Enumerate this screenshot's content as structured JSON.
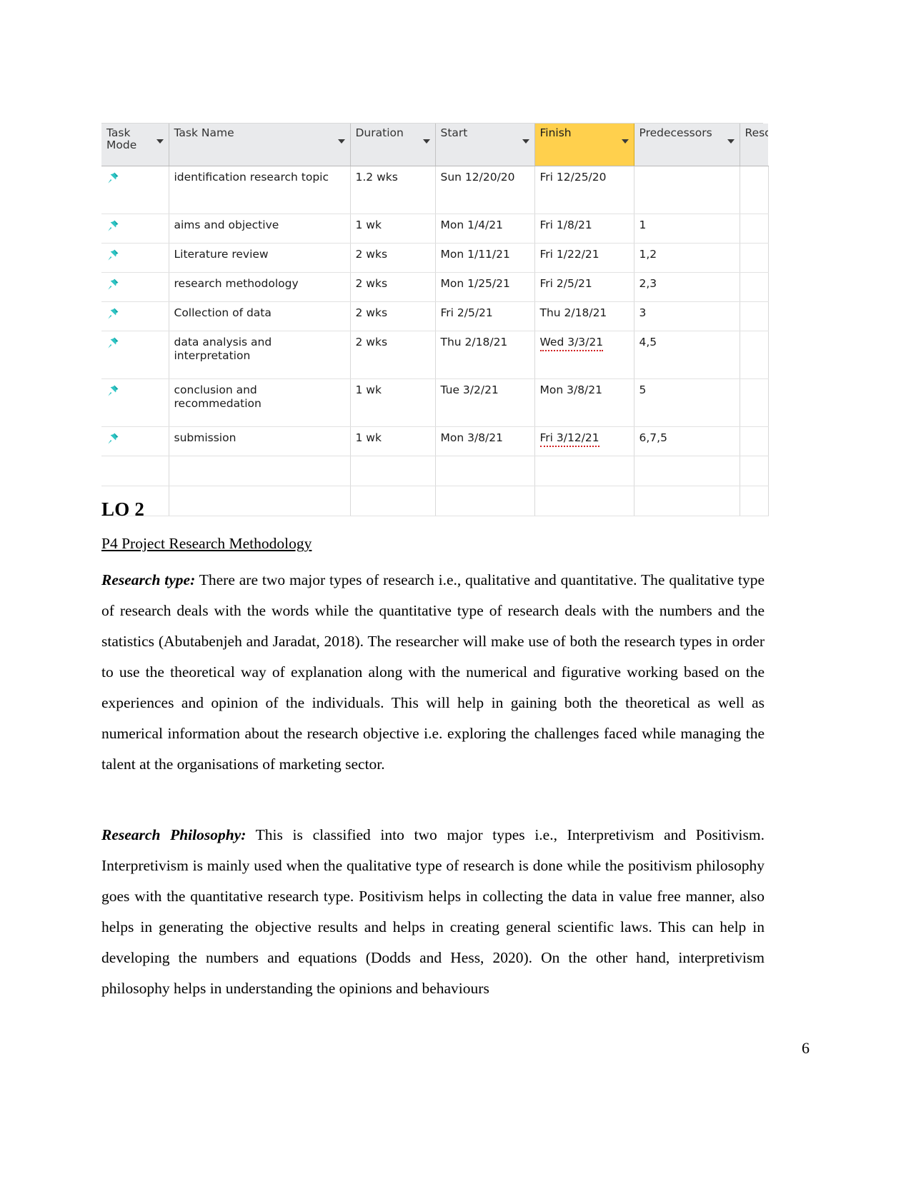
{
  "project_table": {
    "columns": [
      {
        "label": "Task Mode",
        "icon": "chevron-down-icon",
        "highlighted": false
      },
      {
        "label": "Task Name",
        "icon": "chevron-down-icon",
        "highlighted": false
      },
      {
        "label": "Duration",
        "icon": "chevron-down-icon",
        "highlighted": false
      },
      {
        "label": "Start",
        "icon": "chevron-down-icon",
        "highlighted": false
      },
      {
        "label": "Finish",
        "icon": "chevron-down-icon",
        "highlighted": true
      },
      {
        "label": "Predecessors",
        "icon": "chevron-down-icon",
        "highlighted": false
      },
      {
        "label": "Resc",
        "icon": "chevron-down-icon",
        "highlighted": false
      }
    ],
    "rows": [
      {
        "task_mode_icon": "pushpin-icon",
        "task_name": "identification research topic",
        "duration": "1.2 wks",
        "start": "Sun 12/20/20",
        "finish": "Fri 12/25/20",
        "predecessors": "",
        "resource": ""
      },
      {
        "task_mode_icon": "pushpin-icon",
        "task_name": "aims and objective",
        "duration": "1 wk",
        "start": "Mon 1/4/21",
        "finish": "Fri 1/8/21",
        "predecessors": "1",
        "resource": ""
      },
      {
        "task_mode_icon": "pushpin-icon",
        "task_name": "Literature review",
        "duration": "2 wks",
        "start": "Mon 1/11/21",
        "finish": "Fri 1/22/21",
        "predecessors": "1,2",
        "resource": ""
      },
      {
        "task_mode_icon": "pushpin-icon",
        "task_name": "research methodology",
        "duration": "2 wks",
        "start": "Mon 1/25/21",
        "finish": "Fri 2/5/21",
        "predecessors": "2,3",
        "resource": ""
      },
      {
        "task_mode_icon": "pushpin-icon",
        "task_name": "Collection of data",
        "duration": "2 wks",
        "start": "Fri 2/5/21",
        "finish": "Thu 2/18/21",
        "predecessors": "3",
        "resource": ""
      },
      {
        "task_mode_icon": "pushpin-icon",
        "task_name": "data analysis and interpretation",
        "duration": "2 wks",
        "start": "Thu 2/18/21",
        "finish": "Wed 3/3/21",
        "predecessors": "4,5",
        "resource": ""
      },
      {
        "task_mode_icon": "pushpin-icon",
        "task_name": "conclusion and recommedation",
        "duration": "1 wk",
        "start": "Tue 3/2/21",
        "finish": "Mon 3/8/21",
        "predecessors": "5",
        "resource": ""
      },
      {
        "task_mode_icon": "pushpin-icon",
        "task_name": "submission",
        "duration": "1 wk",
        "start": "Mon 3/8/21",
        "finish": "Fri 3/12/21",
        "predecessors": "6,7,5",
        "resource": ""
      }
    ],
    "colors": {
      "header_background": "#e9eaec",
      "header_highlight": "#ffd04d",
      "selection_tint": "#e4edf7",
      "pushpin": "#2ec4c4",
      "spellcheck_underline": "#d01f1f",
      "grid_line": "#e2e2e2"
    }
  },
  "document": {
    "heading": "LO 2",
    "subheading": "P4 Project Research Methodology",
    "paragraph_1": {
      "lead": "Research type:",
      "text": " There are two major types of research i.e., qualitative and quantitative. The qualitative type of research deals with the words while the quantitative type of research deals with the numbers and the statistics (Abutabenjeh and Jaradat, 2018). The researcher will make use of both the research types in order to use the theoretical way of explanation along with the numerical and figurative working based on the experiences and opinion of the individuals. This will help in gaining both the theoretical as well as numerical information about the research objective i.e. exploring the challenges faced while managing the talent at the organisations of marketing sector."
    },
    "paragraph_2": {
      "lead": "Research Philosophy:",
      "text": " This is classified into two major types i.e., Interpretivism and Positivism. Interpretivism is mainly used when the qualitative type of research is done while the positivism philosophy goes with the quantitative research type. Positivism helps in collecting the data in value free manner, also helps in generating the objective results and helps in creating general scientific laws. This can help in developing the numbers and equations (Dodds and Hess, 2020). On the other hand, interpretivism philosophy helps in understanding the opinions and behaviours"
    },
    "page_number": "6"
  }
}
